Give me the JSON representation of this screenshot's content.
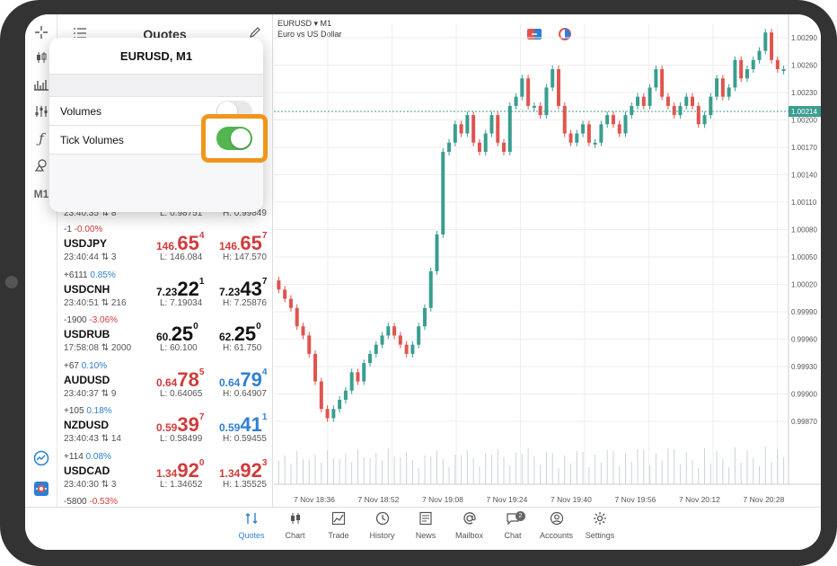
{
  "quotes_panel": {
    "title": "Quotes"
  },
  "popup": {
    "title": "EURUSD, M1",
    "rows": [
      {
        "label": "Volumes",
        "on": false
      },
      {
        "label": "Tick Volumes",
        "on": true
      }
    ]
  },
  "partial_row": {
    "time": "23:40:35",
    "ticks": "8",
    "low": "L: 0.98751",
    "high": "H: 0.99849"
  },
  "quotes": [
    {
      "change": "-1",
      "pct": "-0.00%",
      "pct_sign": "neg",
      "symbol": "USDJPY",
      "time": "23:40:44",
      "ticks": "3",
      "bid": {
        "small": "146.",
        "big": "65",
        "sup": "4",
        "color": "red"
      },
      "ask": {
        "small": "146.",
        "big": "65",
        "sup": "7",
        "color": "red"
      },
      "low": "L: 146.084",
      "high": "H: 147.570"
    },
    {
      "change": "+6111",
      "pct": "0.85%",
      "pct_sign": "pos",
      "symbol": "USDCNH",
      "time": "23:40:51",
      "ticks": "216",
      "bid": {
        "small": "7.23",
        "big": "22",
        "sup": "1",
        "color": "black"
      },
      "ask": {
        "small": "7.23",
        "big": "43",
        "sup": "7",
        "color": "black"
      },
      "low": "L: 7.19034",
      "high": "H: 7.25876"
    },
    {
      "change": "-1900",
      "pct": "-3.06%",
      "pct_sign": "neg",
      "symbol": "USDRUB",
      "time": "17:58:08",
      "ticks": "2000",
      "bid": {
        "small": "60.",
        "big": "25",
        "sup": "0",
        "color": "black"
      },
      "ask": {
        "small": "62.",
        "big": "25",
        "sup": "0",
        "color": "black"
      },
      "low": "L: 60.100",
      "high": "H: 61.750"
    },
    {
      "change": "+67",
      "pct": "0.10%",
      "pct_sign": "pos",
      "symbol": "AUDUSD",
      "time": "23:40:37",
      "ticks": "9",
      "bid": {
        "small": "0.64",
        "big": "78",
        "sup": "5",
        "color": "red"
      },
      "ask": {
        "small": "0.64",
        "big": "79",
        "sup": "4",
        "color": "blue"
      },
      "low": "L: 0.64065",
      "high": "H: 0.64907"
    },
    {
      "change": "+105",
      "pct": "0.18%",
      "pct_sign": "pos",
      "symbol": "NZDUSD",
      "time": "23:40:43",
      "ticks": "14",
      "bid": {
        "small": "0.59",
        "big": "39",
        "sup": "7",
        "color": "red"
      },
      "ask": {
        "small": "0.59",
        "big": "41",
        "sup": "1",
        "color": "blue"
      },
      "low": "L: 0.58499",
      "high": "H: 0.59455"
    },
    {
      "change": "+114",
      "pct": "0.08%",
      "pct_sign": "pos",
      "symbol": "USDCAD",
      "time": "23:40:30",
      "ticks": "3",
      "bid": {
        "small": "1.34",
        "big": "92",
        "sup": "0",
        "color": "red"
      },
      "ask": {
        "small": "1.34",
        "big": "92",
        "sup": "3",
        "color": "red"
      },
      "low": "L: 1.34652",
      "high": "H: 1.35525"
    },
    {
      "change": "-5800",
      "pct": "-0.53%",
      "pct_sign": "neg",
      "symbol": "",
      "time": "",
      "ticks": "",
      "bid": {
        "small": "",
        "big": "",
        "sup": "",
        "color": "red"
      },
      "ask": {
        "small": "",
        "big": "",
        "sup": "",
        "color": "red"
      },
      "low": "",
      "high": ""
    }
  ],
  "chart": {
    "symbol": "EURUSD",
    "timeframe": "M1",
    "description": "Euro vs US Dollar",
    "current_price": "1.00214",
    "y_labels": [
      "1.00290",
      "1.00260",
      "1.00230",
      "1.00200",
      "1.00170",
      "1.00140",
      "1.00110",
      "1.00080",
      "1.00050",
      "1.00020",
      "0.99990",
      "0.99960",
      "0.99930",
      "0.99900",
      "0.99870"
    ],
    "x_labels": [
      "7 Nov 18:36",
      "7 Nov 18:52",
      "7 Nov 19:08",
      "7 Nov 19:24",
      "7 Nov 19:40",
      "7 Nov 19:56",
      "7 Nov 20:12",
      "7 Nov 20:28"
    ],
    "colors": {
      "up": "#3a9e8f",
      "down": "#e0544f",
      "price_line": "#3a9e8f"
    }
  },
  "chart_data": {
    "type": "candlestick",
    "symbol": "EURUSD",
    "timeframe": "M1",
    "y_range": [
      0.99855,
      1.00305
    ],
    "closes": [
      1.0002,
      1.0001,
      1.0,
      0.9998,
      0.9997,
      0.9995,
      0.9992,
      0.9989,
      0.9988,
      0.9989,
      0.999,
      0.9991,
      0.9993,
      0.9992,
      0.9994,
      0.9995,
      0.9996,
      0.9997,
      0.9998,
      0.9997,
      0.9996,
      0.9995,
      0.9996,
      0.9998,
      1.0,
      1.0004,
      1.0008,
      1.0017,
      1.0018,
      1.002,
      1.0019,
      1.0021,
      1.0018,
      1.0017,
      1.0019,
      1.0021,
      1.0018,
      1.0017,
      1.0022,
      1.0023,
      1.0025,
      1.0022,
      1.0022,
      1.0021,
      1.0024,
      1.0026,
      1.0022,
      1.0019,
      1.0018,
      1.0019,
      1.002,
      1.0018,
      1.0018,
      1.002,
      1.0021,
      1.002,
      1.0019,
      1.0021,
      1.0022,
      1.0023,
      1.0022,
      1.0024,
      1.0026,
      1.0023,
      1.0022,
      1.0021,
      1.0022,
      1.0023,
      1.0022,
      1.002,
      1.0021,
      1.0023,
      1.0025,
      1.0023,
      1.0024,
      1.0027,
      1.0025,
      1.0026,
      1.0027,
      1.0028,
      1.003,
      1.0027,
      1.0026,
      1.0026
    ]
  },
  "nav": [
    {
      "label": "Quotes",
      "active": true
    },
    {
      "label": "Chart",
      "active": false
    },
    {
      "label": "Trade",
      "active": false
    },
    {
      "label": "History",
      "active": false
    },
    {
      "label": "News",
      "active": false
    },
    {
      "label": "Mailbox",
      "active": false
    },
    {
      "label": "Chat",
      "active": false,
      "badge": "2"
    },
    {
      "label": "Accounts",
      "active": false
    },
    {
      "label": "Settings",
      "active": false
    }
  ]
}
